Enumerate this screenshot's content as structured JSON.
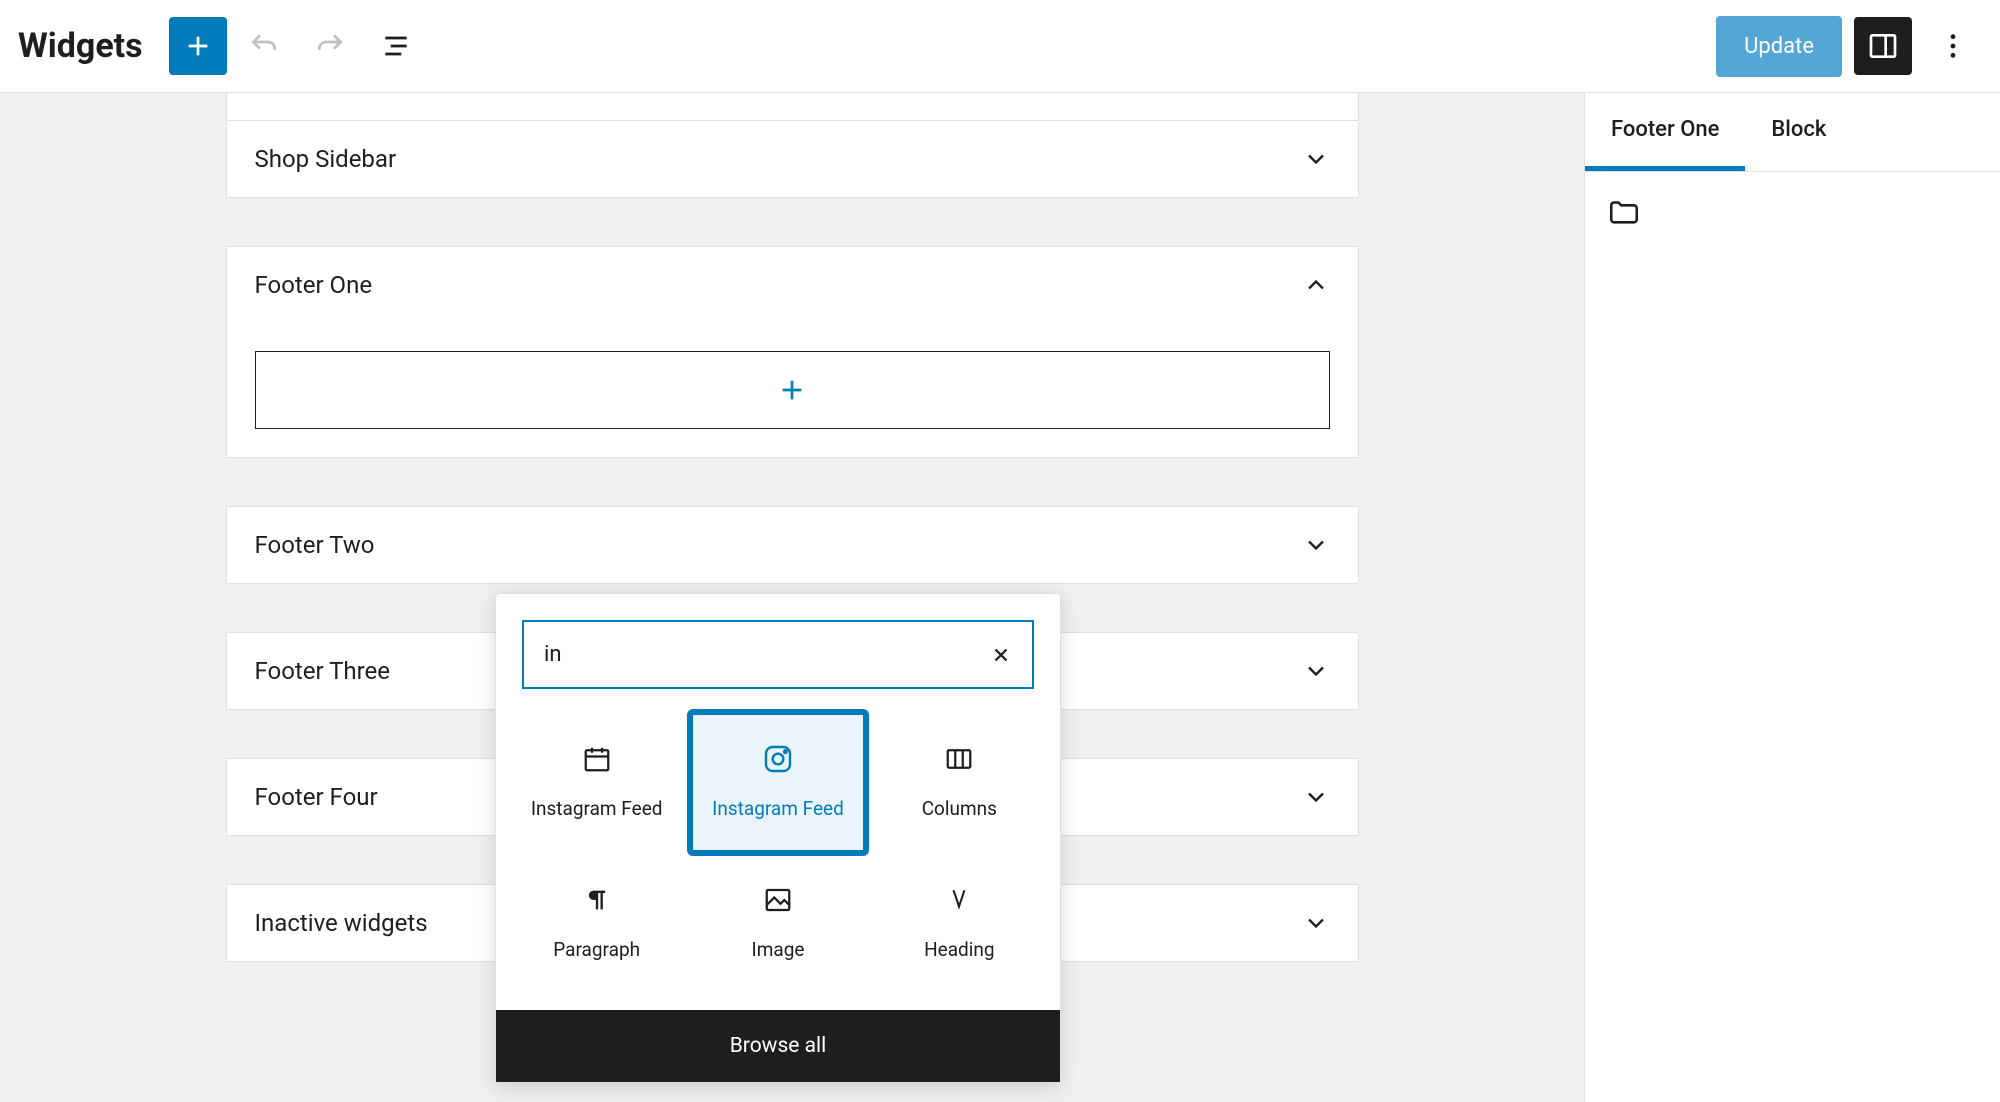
{
  "header": {
    "title": "Widgets",
    "update_label": "Update"
  },
  "widget_areas": {
    "shop_sidebar": "Shop Sidebar",
    "footer_one": "Footer One",
    "footer_two": "Footer Two",
    "footer_three": "Footer Three",
    "footer_four": "Footer Four",
    "inactive": "Inactive widgets"
  },
  "inserter": {
    "search_value": "in",
    "blocks": {
      "instagram_feed_1": "Instagram Feed",
      "instagram_feed_2": "Instagram Feed",
      "columns": "Columns",
      "paragraph": "Paragraph",
      "image": "Image",
      "heading": "Heading"
    },
    "browse_all": "Browse all"
  },
  "sidebar": {
    "tab_area": "Footer One",
    "tab_block": "Block"
  }
}
